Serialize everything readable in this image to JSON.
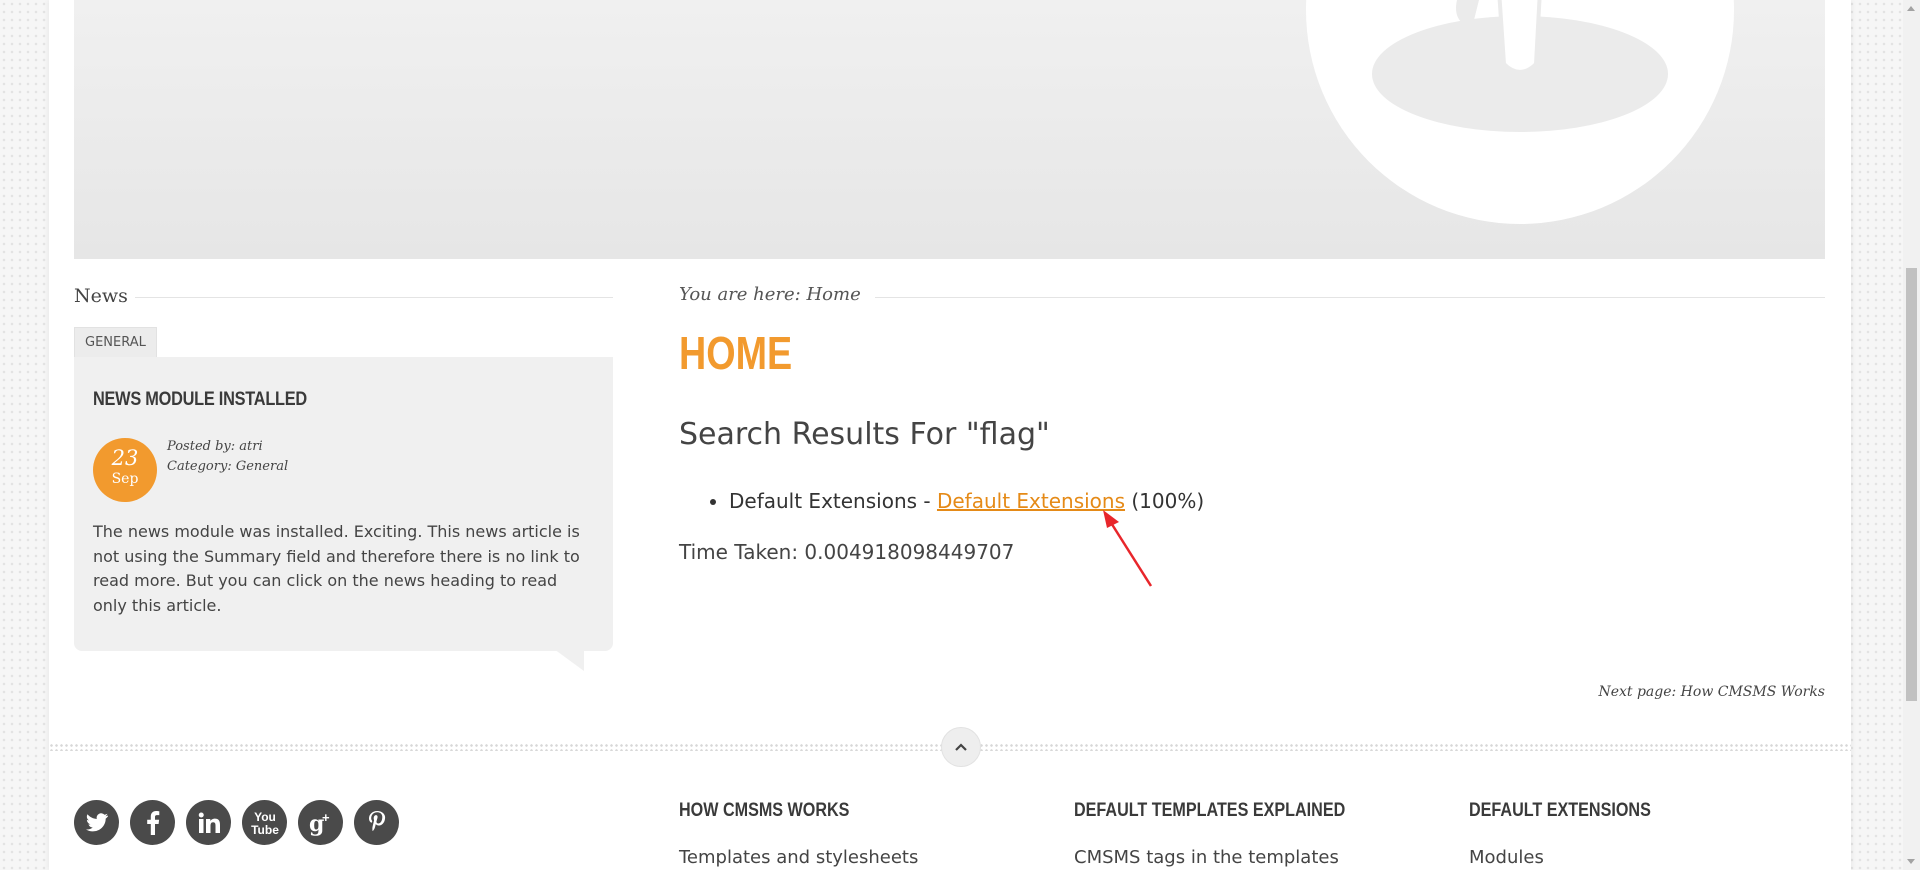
{
  "sidebar": {
    "heading": "News",
    "tag": "GENERAL",
    "article": {
      "title": "NEWS MODULE INSTALLED",
      "day": "23",
      "month": "Sep",
      "posted_by": "Posted by: atri",
      "category": "Category: General",
      "body": "The news module was installed. Exciting. This news article is not using the Summary field and therefore there is no link to read more. But you can click on the news heading to read only this article."
    }
  },
  "main": {
    "breadcrumb": "You are here: Home",
    "title": "HOME",
    "search_heading": "Search Results For \"flag\"",
    "results": [
      {
        "prefix": "Default Extensions - ",
        "link": "Default Extensions",
        "score": " (100%)"
      }
    ],
    "time_taken": "Time Taken: 0.004918098449707",
    "next_page": "Next page: How CMSMS Works"
  },
  "footer": {
    "social_icons": [
      "twitter-icon",
      "facebook-icon",
      "linkedin-icon",
      "youtube-icon",
      "google-plus-icon",
      "pinterest-icon"
    ],
    "columns": [
      {
        "heading": "HOW CMSMS WORKS",
        "link": "Templates and stylesheets"
      },
      {
        "heading": "DEFAULT TEMPLATES EXPLAINED",
        "link": "CMSMS tags in the templates"
      },
      {
        "heading": "DEFAULT EXTENSIONS",
        "link": "Modules"
      }
    ]
  },
  "colors": {
    "accent": "#f29a2e",
    "link": "#e58a17",
    "annotation_arrow": "#e8262b"
  }
}
